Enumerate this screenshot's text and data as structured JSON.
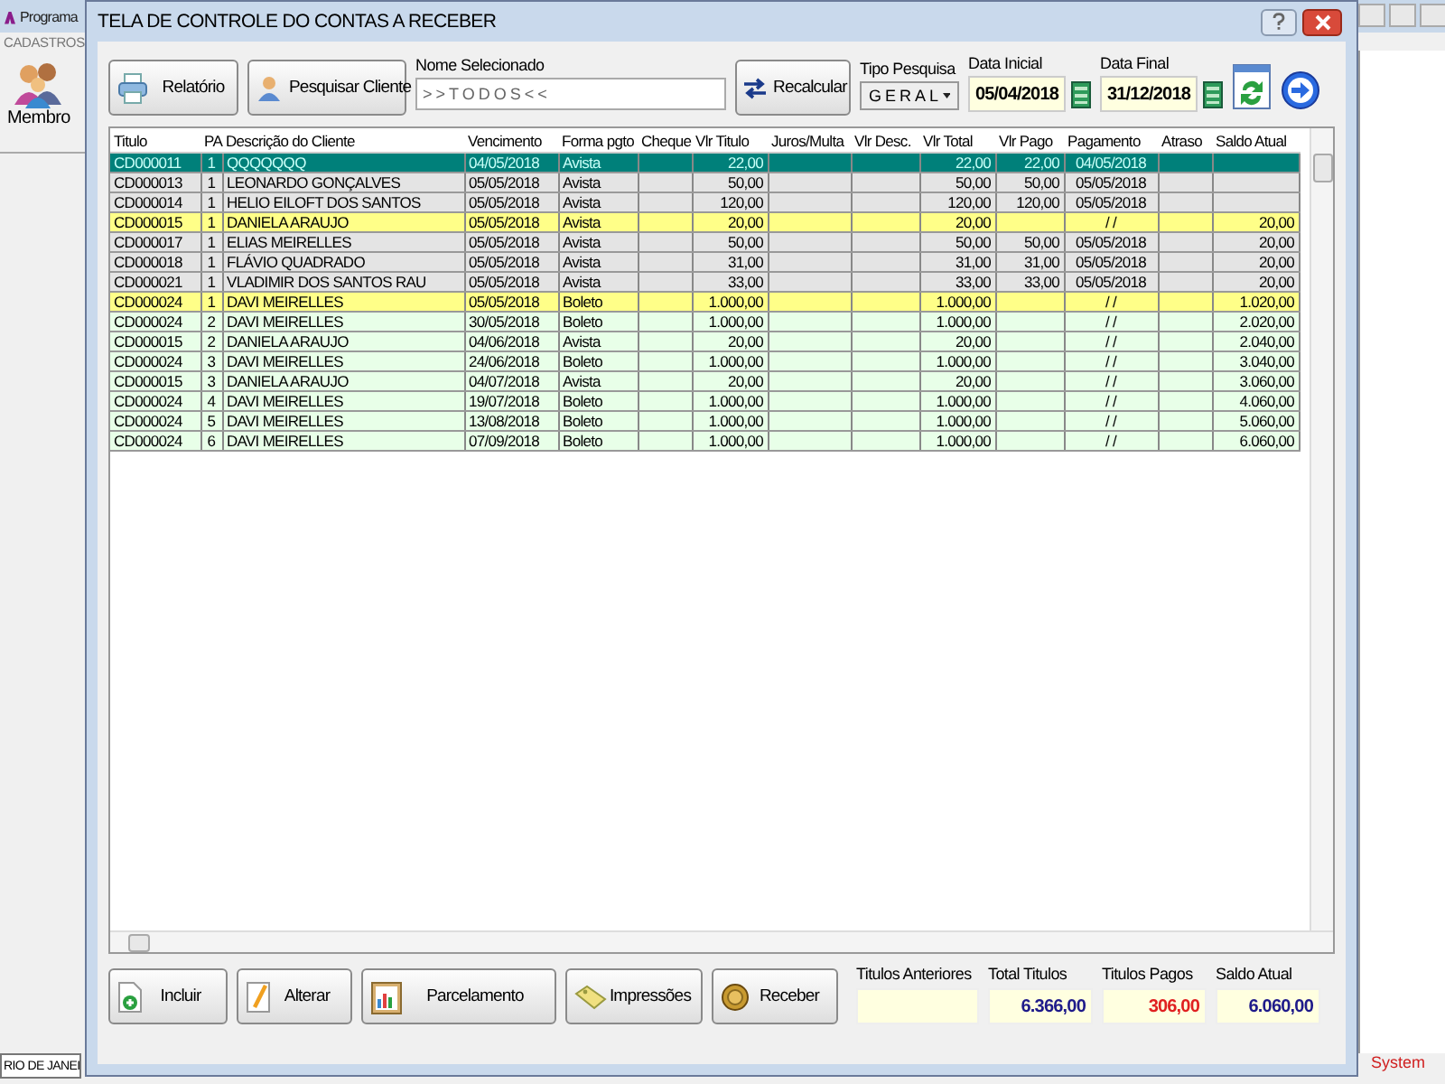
{
  "background_app": {
    "title": "Programa",
    "menu": [
      "CADASTROS"
    ],
    "toolbar": [
      {
        "label": "Membro"
      }
    ],
    "status_left": "RIO DE JANEI",
    "status_right": "System"
  },
  "window": {
    "title": "TELA DE CONTROLE DO CONTAS A RECEBER"
  },
  "toolbar": {
    "report_button": "Relatório",
    "search_client_button": "Pesquisar Cliente",
    "selected_name": {
      "label": "Nome Selecionado",
      "value": ">>TODOS<<"
    },
    "recalc_button": "Recalcular",
    "search_type": {
      "label": "Tipo  Pesquisa",
      "value": "GERAL"
    },
    "start_date": {
      "label": "Data Inicial",
      "value": "05/04/2018"
    },
    "end_date": {
      "label": "Data Final",
      "value": "31/12/2018"
    }
  },
  "table": {
    "columns": [
      "Titulo",
      "PA",
      "Descrição do Cliente",
      "Vencimento",
      "Forma pgto",
      "Cheque",
      "Vlr Titulo",
      "Juros/Multa",
      "Vlr Desc.",
      "Vlr Total",
      "Vlr Pago",
      "Pagamento",
      "Atraso",
      "Saldo Atual"
    ],
    "rows": [
      {
        "kind": "paid",
        "selected": true,
        "titulo": "CD000011",
        "pa": "1",
        "descricao": "QQQQQQQ",
        "vencimento": "04/05/2018",
        "forma_pgto": "Avista",
        "vlr_titulo": "22,00",
        "vlr_total": "22,00",
        "vlr_pago": "22,00",
        "pagamento": "04/05/2018"
      },
      {
        "kind": "paid",
        "selected": false,
        "titulo": "CD000013",
        "pa": "1",
        "descricao": "LEONARDO GONÇALVES",
        "vencimento": "05/05/2018",
        "forma_pgto": "Avista",
        "vlr_titulo": "50,00",
        "vlr_total": "50,00",
        "vlr_pago": "50,00",
        "pagamento": "05/05/2018"
      },
      {
        "kind": "paid",
        "selected": false,
        "titulo": "CD000014",
        "pa": "1",
        "descricao": "HELIO EILOFT DOS SANTOS",
        "vencimento": "05/05/2018",
        "forma_pgto": "Avista",
        "vlr_titulo": "120,00",
        "vlr_total": "120,00",
        "vlr_pago": "120,00",
        "pagamento": "05/05/2018"
      },
      {
        "kind": "due",
        "selected": false,
        "titulo": "CD000015",
        "pa": "1",
        "descricao": "DANIELA ARAUJO",
        "vencimento": "05/05/2018",
        "forma_pgto": "Avista",
        "vlr_titulo": "20,00",
        "vlr_total": "20,00",
        "pagamento": "/ /",
        "saldo_atual": "20,00"
      },
      {
        "kind": "paid",
        "selected": false,
        "titulo": "CD000017",
        "pa": "1",
        "descricao": "ELIAS MEIRELLES",
        "vencimento": "05/05/2018",
        "forma_pgto": "Avista",
        "vlr_titulo": "50,00",
        "vlr_total": "50,00",
        "vlr_pago": "50,00",
        "pagamento": "05/05/2018",
        "saldo_atual": "20,00"
      },
      {
        "kind": "paid",
        "selected": false,
        "titulo": "CD000018",
        "pa": "1",
        "descricao": "FLÁVIO QUADRADO",
        "vencimento": "05/05/2018",
        "forma_pgto": "Avista",
        "vlr_titulo": "31,00",
        "vlr_total": "31,00",
        "vlr_pago": "31,00",
        "pagamento": "05/05/2018",
        "saldo_atual": "20,00"
      },
      {
        "kind": "paid",
        "selected": false,
        "titulo": "CD000021",
        "pa": "1",
        "descricao": "VLADIMIR DOS SANTOS RAU",
        "vencimento": "05/05/2018",
        "forma_pgto": "Avista",
        "vlr_titulo": "33,00",
        "vlr_total": "33,00",
        "vlr_pago": "33,00",
        "pagamento": "05/05/2018",
        "saldo_atual": "20,00"
      },
      {
        "kind": "due",
        "selected": false,
        "titulo": "CD000024",
        "pa": "1",
        "descricao": "DAVI MEIRELLES",
        "vencimento": "05/05/2018",
        "forma_pgto": "Boleto",
        "vlr_titulo": "1.000,00",
        "vlr_total": "1.000,00",
        "pagamento": "/ /",
        "saldo_atual": "1.020,00"
      },
      {
        "kind": "open",
        "selected": false,
        "titulo": "CD000024",
        "pa": "2",
        "descricao": "DAVI MEIRELLES",
        "vencimento": "30/05/2018",
        "forma_pgto": "Boleto",
        "vlr_titulo": "1.000,00",
        "vlr_total": "1.000,00",
        "pagamento": "/ /",
        "saldo_atual": "2.020,00"
      },
      {
        "kind": "open",
        "selected": false,
        "titulo": "CD000015",
        "pa": "2",
        "descricao": "DANIELA ARAUJO",
        "vencimento": "04/06/2018",
        "forma_pgto": "Avista",
        "vlr_titulo": "20,00",
        "vlr_total": "20,00",
        "pagamento": "/ /",
        "saldo_atual": "2.040,00"
      },
      {
        "kind": "open",
        "selected": false,
        "titulo": "CD000024",
        "pa": "3",
        "descricao": "DAVI MEIRELLES",
        "vencimento": "24/06/2018",
        "forma_pgto": "Boleto",
        "vlr_titulo": "1.000,00",
        "vlr_total": "1.000,00",
        "pagamento": "/ /",
        "saldo_atual": "3.040,00"
      },
      {
        "kind": "open",
        "selected": false,
        "titulo": "CD000015",
        "pa": "3",
        "descricao": "DANIELA ARAUJO",
        "vencimento": "04/07/2018",
        "forma_pgto": "Avista",
        "vlr_titulo": "20,00",
        "vlr_total": "20,00",
        "pagamento": "/ /",
        "saldo_atual": "3.060,00"
      },
      {
        "kind": "open",
        "selected": false,
        "titulo": "CD000024",
        "pa": "4",
        "descricao": "DAVI MEIRELLES",
        "vencimento": "19/07/2018",
        "forma_pgto": "Boleto",
        "vlr_titulo": "1.000,00",
        "vlr_total": "1.000,00",
        "pagamento": "/ /",
        "saldo_atual": "4.060,00"
      },
      {
        "kind": "open",
        "selected": false,
        "titulo": "CD000024",
        "pa": "5",
        "descricao": "DAVI MEIRELLES",
        "vencimento": "13/08/2018",
        "forma_pgto": "Boleto",
        "vlr_titulo": "1.000,00",
        "vlr_total": "1.000,00",
        "pagamento": "/ /",
        "saldo_atual": "5.060,00"
      },
      {
        "kind": "open",
        "selected": false,
        "titulo": "CD000024",
        "pa": "6",
        "descricao": "DAVI MEIRELLES",
        "vencimento": "07/09/2018",
        "forma_pgto": "Boleto",
        "vlr_titulo": "1.000,00",
        "vlr_total": "1.000,00",
        "pagamento": "/ /",
        "saldo_atual": "6.060,00"
      }
    ]
  },
  "buttons": [
    "Incluir",
    "Alterar",
    "Parcelamento",
    "Impressões",
    "Receber"
  ],
  "totals": [
    {
      "label": "Titulos Anteriores",
      "kind": "normal"
    },
    {
      "label": "Total Titulos",
      "value": "6.366,00",
      "kind": "normal"
    },
    {
      "label": "Titulos Pagos",
      "value": "306,00",
      "kind": "paid"
    },
    {
      "label": "Saldo Atual",
      "value": "6.060,00",
      "kind": "normal"
    }
  ]
}
